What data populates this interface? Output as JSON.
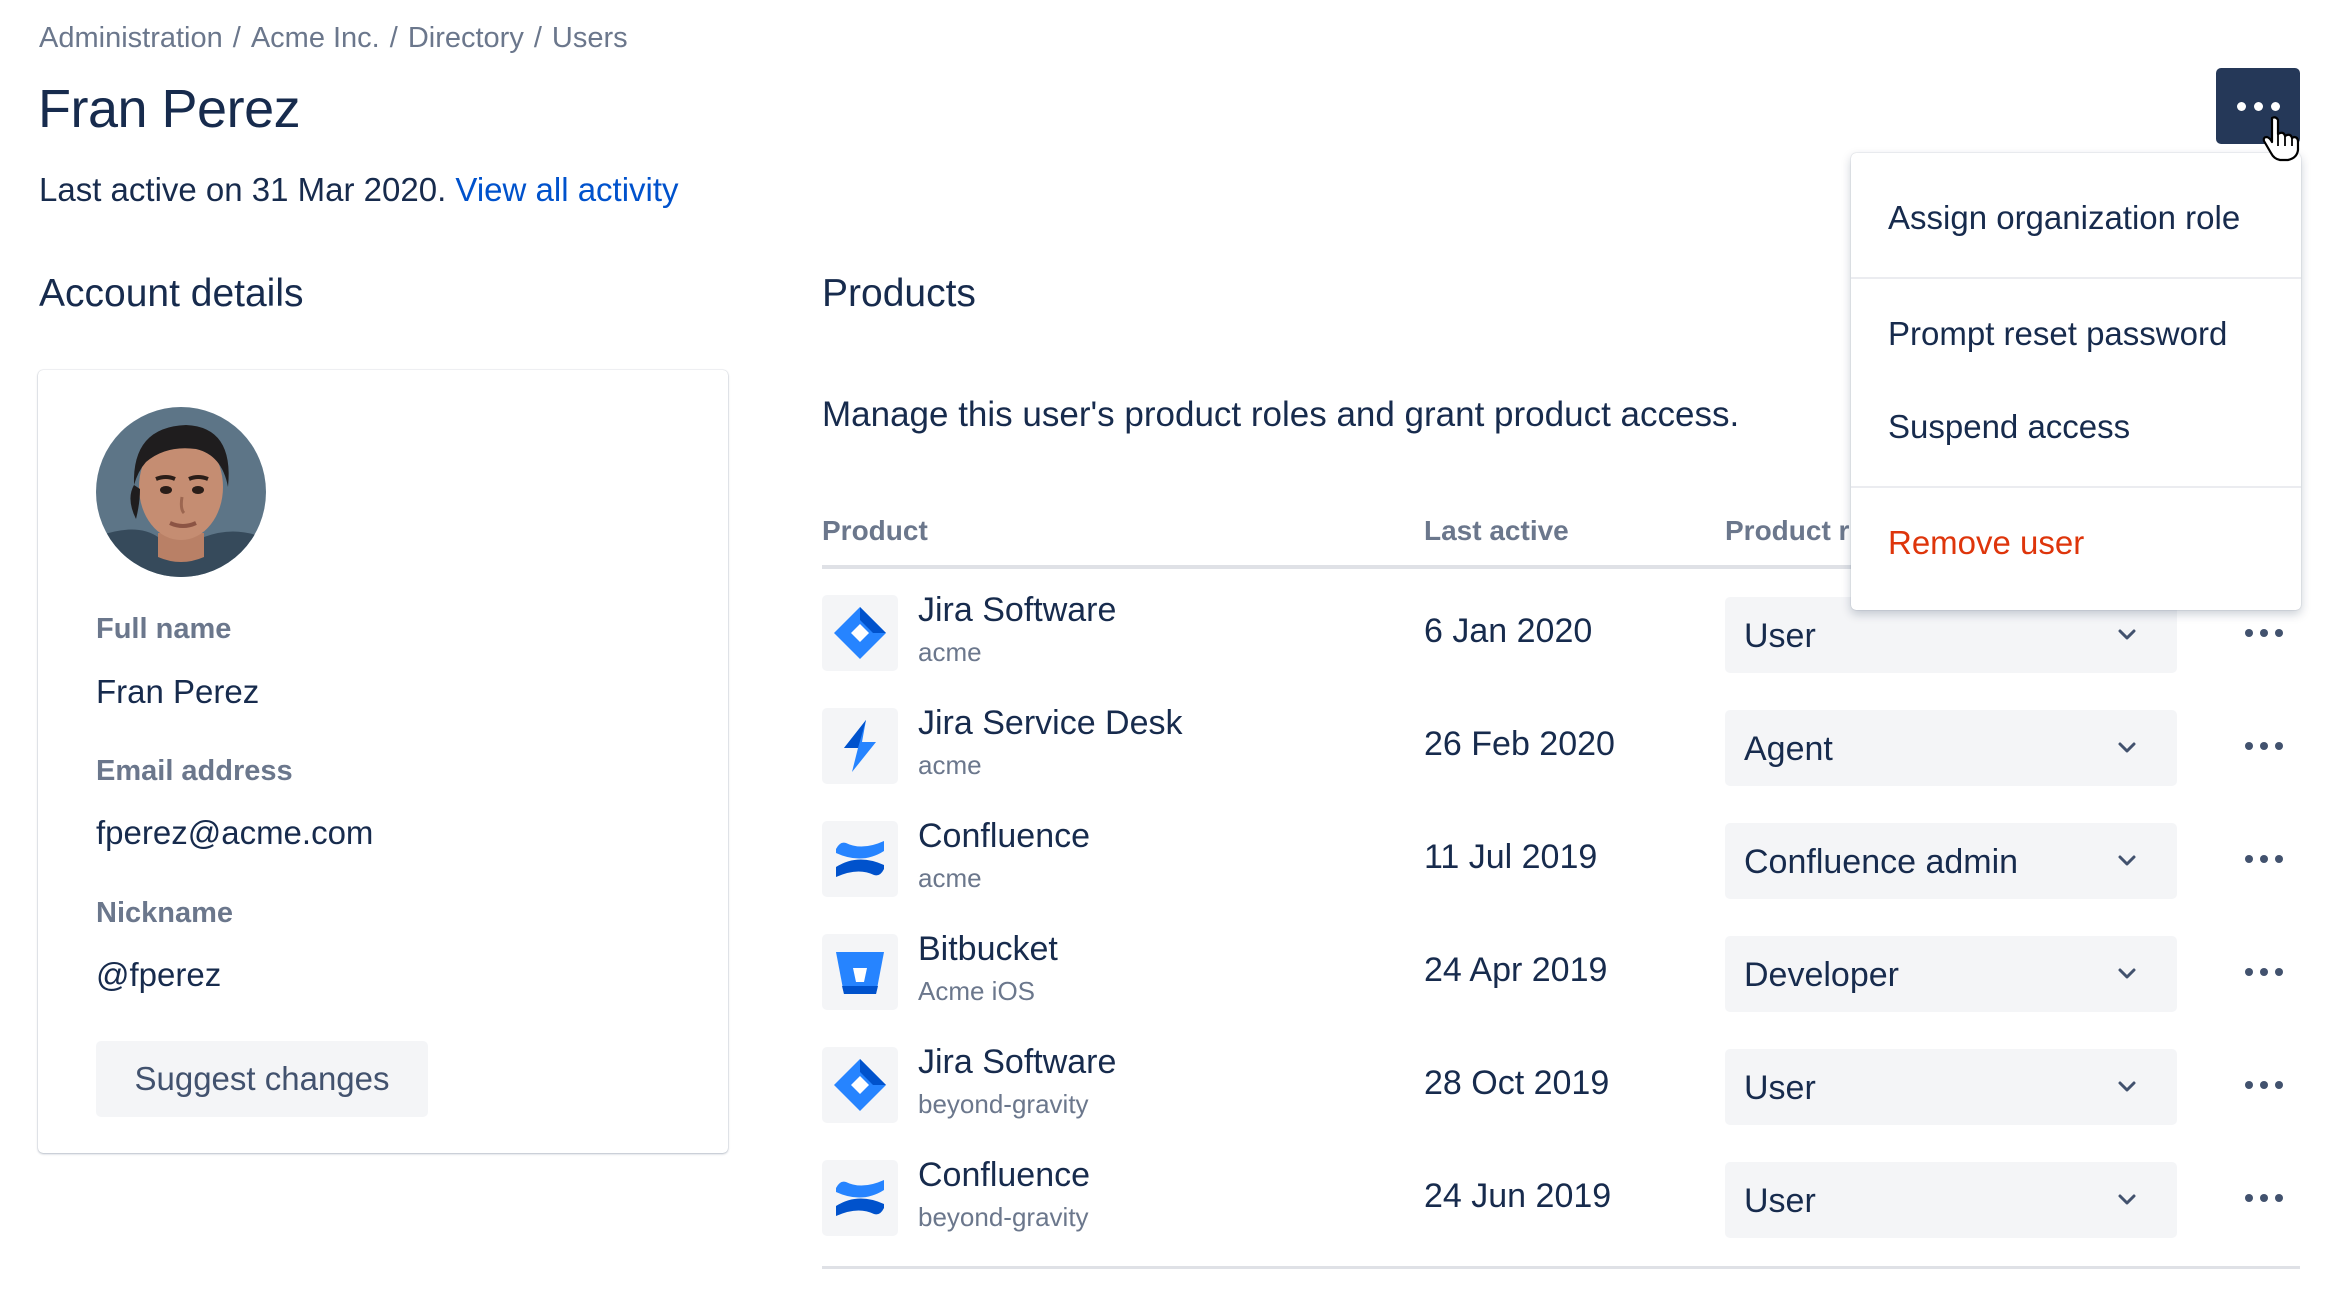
{
  "breadcrumb": [
    "Administration",
    "Acme Inc.",
    "Directory",
    "Users"
  ],
  "breadcrumb_separator": "/",
  "page_title": "Fran Perez",
  "last_active": {
    "text": "Last active on 31 Mar 2020.",
    "link": "View all activity"
  },
  "account": {
    "title": "Account details",
    "fields": [
      {
        "label": "Full name",
        "value": "Fran Perez"
      },
      {
        "label": "Email address",
        "value": "fperez@acme.com"
      },
      {
        "label": "Nickname",
        "value": "@fperez"
      }
    ],
    "suggest_button": "Suggest changes"
  },
  "products": {
    "title": "Products",
    "description": "Manage this user's product roles and grant product access.",
    "columns": {
      "product": "Product",
      "last_active": "Last active",
      "role": "Product r"
    },
    "rows": [
      {
        "name": "Jira Software",
        "site": "acme",
        "last_active": "6 Jan 2020",
        "role": "User",
        "icon": "jira-software-icon"
      },
      {
        "name": "Jira Service Desk",
        "site": "acme",
        "last_active": "26 Feb 2020",
        "role": "Agent",
        "icon": "jira-service-desk-icon"
      },
      {
        "name": "Confluence",
        "site": "acme",
        "last_active": "11 Jul 2019",
        "role": "Confluence admin",
        "icon": "confluence-icon"
      },
      {
        "name": "Bitbucket",
        "site": "Acme iOS",
        "last_active": "24 Apr 2019",
        "role": "Developer",
        "icon": "bitbucket-icon"
      },
      {
        "name": "Jira Software",
        "site": "beyond-gravity",
        "last_active": "28 Oct 2019",
        "role": "User",
        "icon": "jira-software-icon"
      },
      {
        "name": "Confluence",
        "site": "beyond-gravity",
        "last_active": "24 Jun 2019",
        "role": "User",
        "icon": "confluence-icon"
      }
    ]
  },
  "menu": {
    "items": [
      {
        "label": "Assign organization role",
        "danger": false
      },
      {
        "label": "Prompt reset password",
        "danger": false
      },
      {
        "label": "Suspend access",
        "danger": false
      },
      {
        "label": "Remove user",
        "danger": true
      }
    ]
  },
  "colors": {
    "brand_blue": "#0052cc",
    "dark_button": "#253858",
    "danger": "#de350b",
    "text": "#172b4d",
    "subtle_text": "#6b778c"
  }
}
